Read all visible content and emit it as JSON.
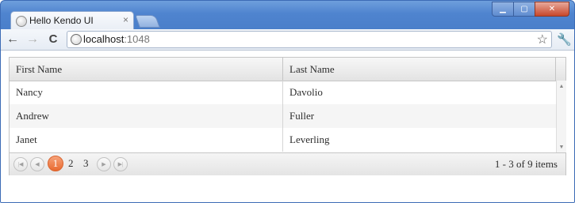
{
  "browser": {
    "tab_title": "Hello Kendo UI",
    "tab_close": "×",
    "url_host": "localhost",
    "url_port": ":1048",
    "back": "←",
    "forward": "→",
    "reload": "C",
    "star": "☆",
    "wrench": "🔧",
    "win_min": "▁",
    "win_max": "▢",
    "win_close": "✕"
  },
  "grid": {
    "columns": [
      "First Name",
      "Last Name"
    ],
    "rows": [
      {
        "first": "Nancy",
        "last": "Davolio"
      },
      {
        "first": "Andrew",
        "last": "Fuller"
      },
      {
        "first": "Janet",
        "last": "Leverling"
      }
    ]
  },
  "pager": {
    "first": "|◀",
    "prev": "◀",
    "next": "▶",
    "last": "▶|",
    "pages": [
      "1",
      "2",
      "3"
    ],
    "current_page": "1",
    "info": "1 - 3 of 9 items"
  }
}
